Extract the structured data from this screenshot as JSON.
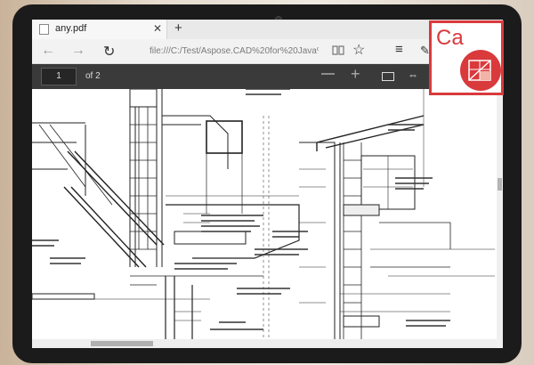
{
  "browser": {
    "tab_title": "any.pdf",
    "tab_close": "✕",
    "new_tab": "+",
    "url": "file:///C:/Test/Aspose.CAD%20for%20Java%2C"
  },
  "viewer": {
    "page_number": "1",
    "page_total": "of 2",
    "zoom_out": "—",
    "zoom_in": "+"
  },
  "logo": {
    "text": "Ca"
  },
  "colors": {
    "accent": "#d93a3c",
    "toolbar": "#3a3a3a"
  }
}
